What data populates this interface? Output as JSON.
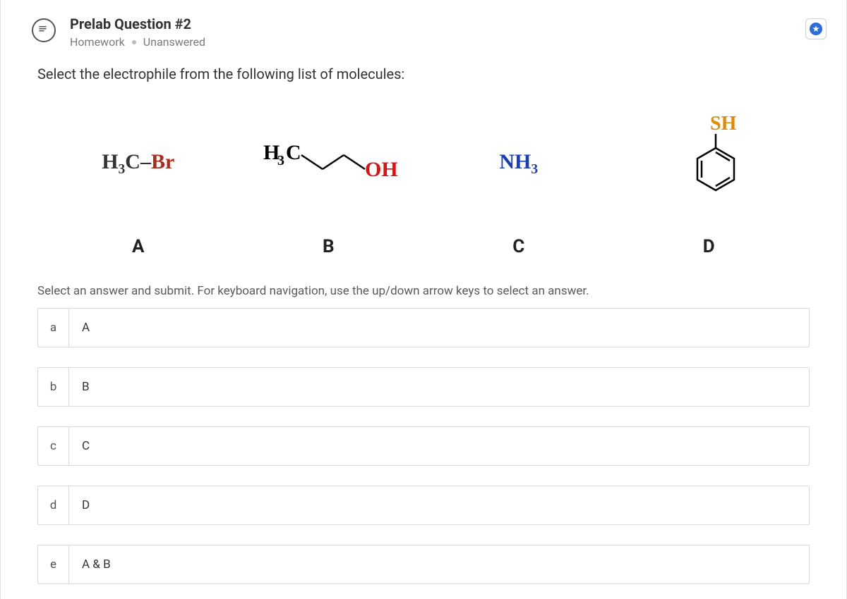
{
  "header": {
    "title": "Prelab Question #2",
    "category": "Homework",
    "status": "Unanswered"
  },
  "question": {
    "prompt": "Select the electrophile from the following list of molecules:",
    "instruction": "Select an answer and submit. For keyboard navigation, use the up/down arrow keys to select an answer."
  },
  "molecules": [
    {
      "label": "A",
      "display": "H3C–Br"
    },
    {
      "label": "B",
      "display": "H3C–CH2–CH2–OH"
    },
    {
      "label": "C",
      "display": "NH3"
    },
    {
      "label": "D",
      "display": "thiophenol (C6H5SH)"
    }
  ],
  "options": [
    {
      "key": "a",
      "text": "A"
    },
    {
      "key": "b",
      "text": "B"
    },
    {
      "key": "c",
      "text": "C"
    },
    {
      "key": "d",
      "text": "D"
    },
    {
      "key": "e",
      "text": "A & B"
    }
  ],
  "icons": {
    "question": "chat-question-icon",
    "bookmark": "star-icon"
  }
}
